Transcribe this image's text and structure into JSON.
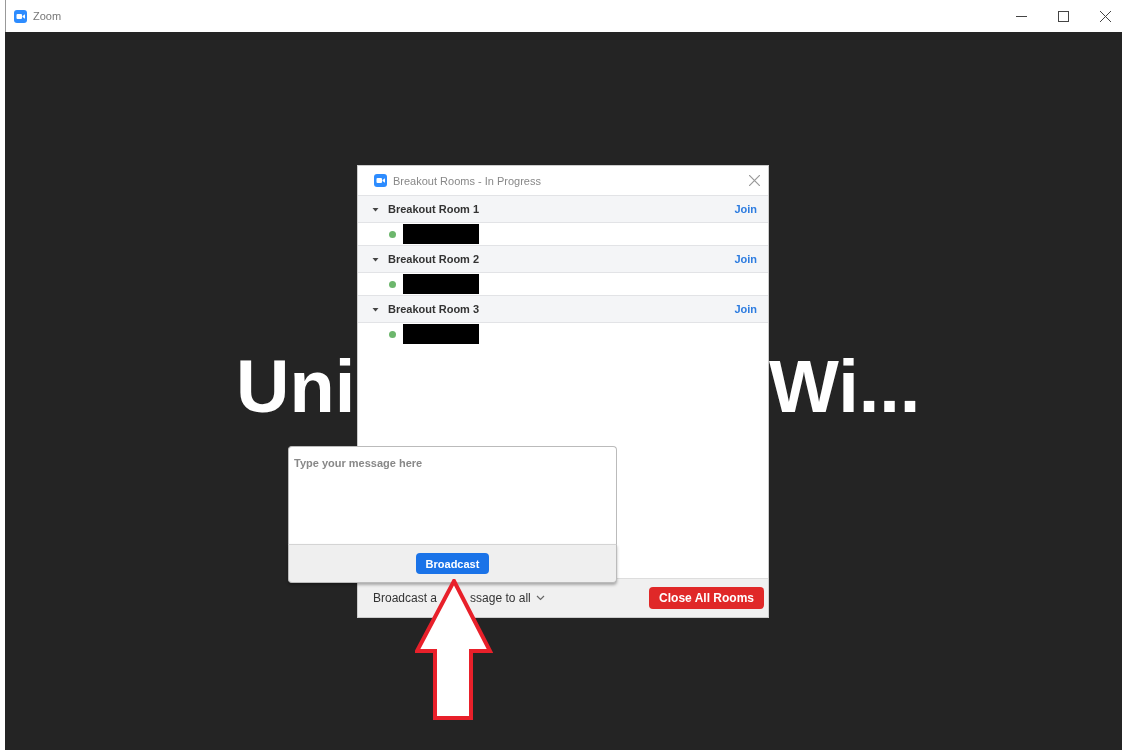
{
  "window": {
    "title": "Zoom"
  },
  "background_title": {
    "left_part": "Uni",
    "right_part": "Wi..."
  },
  "dialog": {
    "title": "Breakout Rooms - In Progress",
    "rooms": [
      {
        "name": "Breakout Room 1",
        "expanded": true,
        "action": "Join",
        "participants": [
          {
            "color": "#6cb66c"
          }
        ]
      },
      {
        "name": "Breakout Room 2",
        "expanded": true,
        "action": "Join",
        "participants": [
          {
            "color": "#6cb66c"
          }
        ]
      },
      {
        "name": "Breakout Room 3",
        "expanded": true,
        "action": "Join",
        "participants": [
          {
            "color": "#6cb66c"
          }
        ]
      }
    ],
    "footer": {
      "broadcast_menu_parts": [
        "Broadcast a",
        "ssage to all"
      ],
      "close_button": "Close All Rooms"
    }
  },
  "broadcast_popup": {
    "placeholder": "Type your message here",
    "button": "Broadcast"
  }
}
